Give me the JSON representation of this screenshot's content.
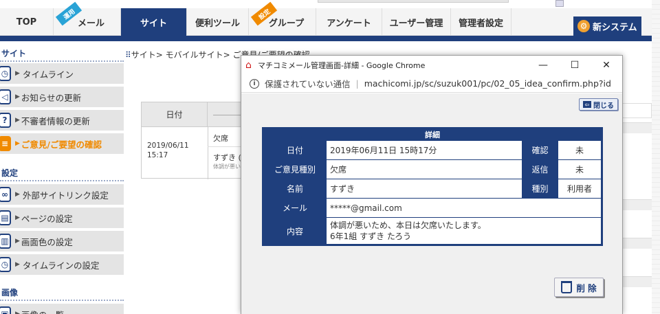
{
  "nav": {
    "tabs": [
      {
        "label": "TOP"
      },
      {
        "label": "メール",
        "ribbon": "運用"
      },
      {
        "label": "サイト"
      },
      {
        "label": "便利ツール"
      },
      {
        "label": "グループ",
        "ribbon": "設定"
      },
      {
        "label": "アンケート"
      },
      {
        "label": "ユーザー管理"
      },
      {
        "label": "管理者設定"
      }
    ],
    "new_system": "新システム"
  },
  "sidebar": {
    "sections": [
      "サイト",
      "設定",
      "画像"
    ],
    "items": [
      {
        "label": "タイムライン",
        "icon": "clock-icon"
      },
      {
        "label": "お知らせの更新",
        "icon": "megaphone-icon"
      },
      {
        "label": "不審者情報の更新",
        "icon": "question-icon"
      },
      {
        "label": "ご意見/ご要望の確認",
        "icon": "list-icon"
      },
      {
        "label": "外部サイトリンク設定",
        "icon": "link-icon"
      },
      {
        "label": "ページの設定",
        "icon": "page-icon"
      },
      {
        "label": "画面色の設定",
        "icon": "brush-icon"
      },
      {
        "label": "タイムラインの設定",
        "icon": "clock-icon"
      },
      {
        "label": "画像の一覧",
        "icon": "image-icon"
      }
    ]
  },
  "breadcrumb": "サイト> モバイルサイト> ご意見/ご要望の確認",
  "bg_table": {
    "header_date": "日付",
    "date": "2019/06/11",
    "time": "15:17",
    "row1": "欠席",
    "row2": "すずき (",
    "row3": "体調が悪い"
  },
  "popup": {
    "title": "マチコミメール管理画面-詳細 - Google Chrome",
    "minimize": "—",
    "maximize": "☐",
    "close": "✕",
    "info_icon": "i",
    "security_text": "保護されていない通信",
    "separator": "|",
    "url": "machicomi.jp/sc/suzuk001/pc/02_05_idea_confirm.php?id=...",
    "close_button": "閉じる",
    "detail": {
      "header": "詳細",
      "date_label": "日付",
      "date_value": "2019年06月11日 15時17分",
      "confirm_label": "確認",
      "confirm_value": "未",
      "type_label": "ご意見種別",
      "type_value": "欠席",
      "reply_label": "返信",
      "reply_value": "未",
      "name_label": "名前",
      "name_value": "すずき",
      "kind_label": "種別",
      "kind_value": "利用者",
      "mail_label": "メール",
      "mail_value": "*****@gmail.com",
      "content_label": "内容",
      "content_line1": "体調が悪いため、本日は欠席いたします。",
      "content_line2": "6年1組 すずき たろう"
    },
    "delete_button": "削 除"
  },
  "colors": {
    "navy": "#1f3f7d",
    "orange": "#f08a00"
  }
}
